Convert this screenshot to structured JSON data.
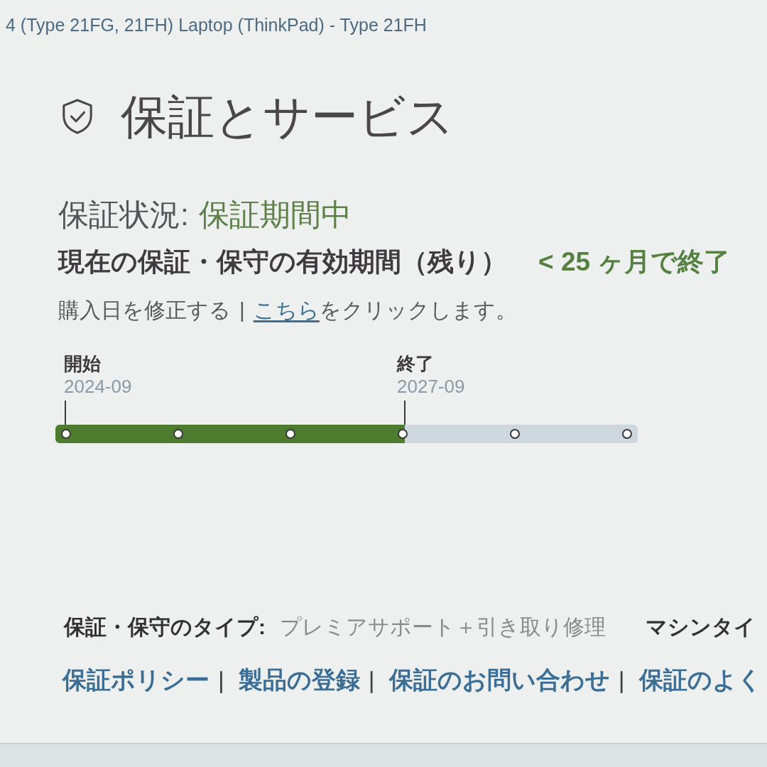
{
  "breadcrumb": "4 (Type 21FG, 21FH) Laptop (ThinkPad) - Type 21FH",
  "heading": {
    "title": "保証とサービス"
  },
  "status": {
    "label": "保証状況:",
    "value": "保証期間中"
  },
  "remaining": {
    "label": "現在の保証・保守の有効期間（残り）",
    "value": "< 25 ヶ月で終了"
  },
  "purchase_date": {
    "label": "購入日を修正する",
    "separator": "|",
    "link": "こちら",
    "text": "をクリックします。"
  },
  "timeline": {
    "start": {
      "label": "開始",
      "date": "2024-09"
    },
    "end": {
      "label": "終了",
      "date": "2027-09"
    },
    "level": 0.6
  },
  "warranty_type": {
    "label": "保証・保守のタイプ:",
    "value": "プレミアサポート＋引き取り修理"
  },
  "machine_type": {
    "label": "マシンタイ"
  },
  "links": [
    {
      "label": "保証ポリシー",
      "separator": "|"
    },
    {
      "label": "製品の登録",
      "separator": "|"
    },
    {
      "label": "保証のお問い合わせ",
      "separator": "|"
    },
    {
      "label": "保証のよく"
    }
  ]
}
